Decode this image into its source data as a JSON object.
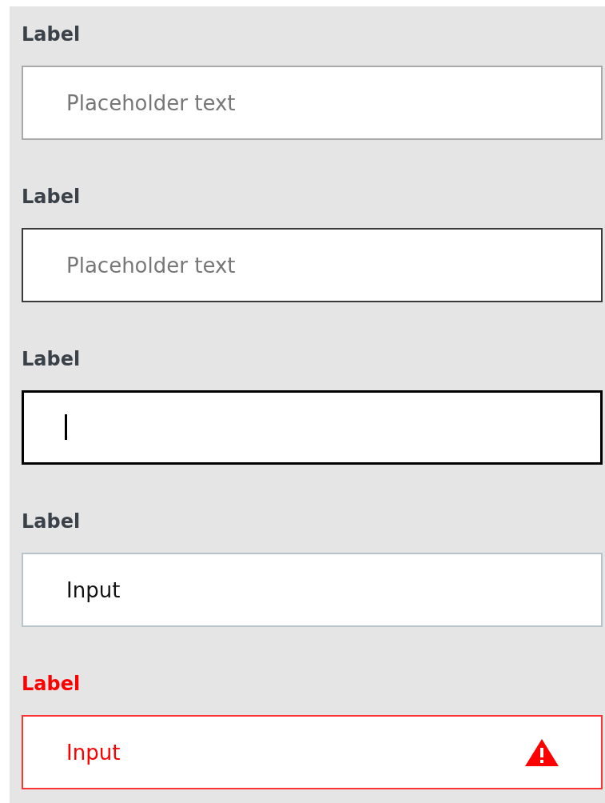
{
  "fields": [
    {
      "kind": "default",
      "label": "Label",
      "placeholder": "Placeholder text"
    },
    {
      "kind": "hover",
      "label": "Label",
      "placeholder": "Placeholder text"
    },
    {
      "kind": "focus",
      "label": "Label"
    },
    {
      "kind": "filled",
      "label": "Label",
      "value": "Input"
    },
    {
      "kind": "error",
      "label": "Label",
      "value": "Input"
    }
  ]
}
